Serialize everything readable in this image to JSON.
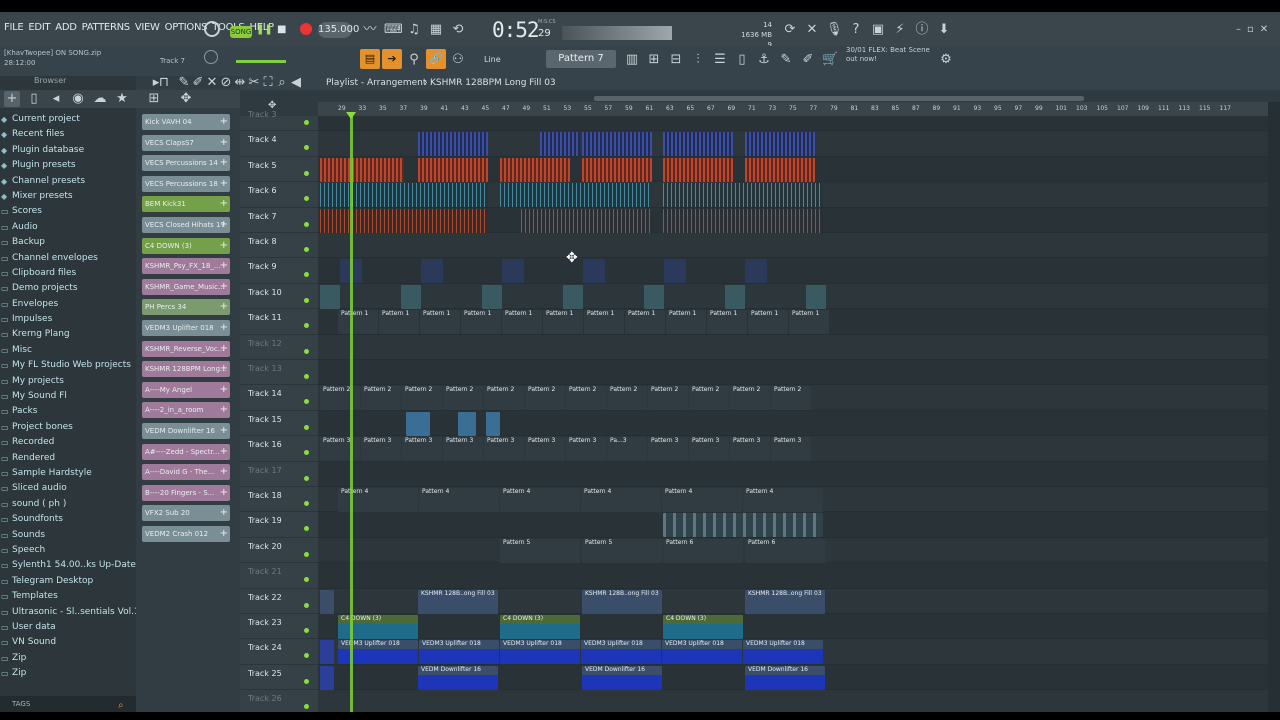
{
  "menu": [
    "FILE",
    "EDIT",
    "ADD",
    "PATTERNS",
    "VIEW",
    "OPTIONS",
    "TOOLS",
    "HELP"
  ],
  "transport": {
    "song_label": "SONG",
    "tempo": "135.000",
    "time": "0:52",
    "time_small": "29",
    "time_label": "M:S:CS"
  },
  "cpu": {
    "line1": "14",
    "line2": "1636 MB",
    "line3": "9"
  },
  "file": {
    "user": "[KhavTwopee]",
    "song": "ON SONG.zip",
    "time": "28:12:00"
  },
  "hint_track": "Track 7",
  "snap": "Line",
  "pattern_selector": "Pattern 7",
  "hint": {
    "line1": "30/01  FLEX: Beat Scene",
    "line2": "out now!"
  },
  "browser": {
    "title": "Browser",
    "items": [
      "Current project",
      "Recent files",
      "Plugin database",
      "Plugin presets",
      "Channel presets",
      "Mixer presets",
      "Scores",
      "Audio",
      "Backup",
      "Channel envelopes",
      "Clipboard files",
      "Demo projects",
      "Envelopes",
      "Impulses",
      "Krerng Plang",
      "Misc",
      "My FL Studio Web projects",
      "My projects",
      "My Sound Fl",
      "Packs",
      "Project bones",
      "Recorded",
      "Rendered",
      "Sample Hardstyle",
      "Sliced audio",
      "sound ( ph )",
      "Soundfonts",
      "Sounds",
      "Speech",
      "Sylenth1 54.00..ks Up-Date 5",
      "Telegram Desktop",
      "Templates",
      "Ultrasonic - Sl..sentials Vol.1",
      "User data",
      "VN Sound",
      "Zip",
      "Zip"
    ],
    "tags": "TAGS"
  },
  "channels": [
    {
      "name": "Kick VAVH 04",
      "color": "#7a8e95"
    },
    {
      "name": "VECS ClapsS7",
      "color": "#7a8e95"
    },
    {
      "name": "VECS Percussions 14",
      "color": "#7a8e95"
    },
    {
      "name": "VECS Percussions 18",
      "color": "#7a8e95"
    },
    {
      "name": "BEM Kick31",
      "color": "#74a04a"
    },
    {
      "name": "VECS Closed Hihats 17",
      "color": "#7a8e95"
    },
    {
      "name": "C4 DOWN (3)",
      "color": "#74a04a"
    },
    {
      "name": "KSHMR_Psy_FX_18_...",
      "color": "#a07a9a"
    },
    {
      "name": "KSHMR_Game_Music...",
      "color": "#a07a9a"
    },
    {
      "name": "PH Percs 34",
      "color": "#7b9a6e"
    },
    {
      "name": "VEDM3 Uplifter 018",
      "color": "#7a8e95"
    },
    {
      "name": "KSHMR_Reverse_Voc...",
      "color": "#a07a9a"
    },
    {
      "name": "KSHMR 128BPM Long...",
      "color": "#a07a9a"
    },
    {
      "name": "A----My Angel",
      "color": "#a07a9a"
    },
    {
      "name": "A----2_in_a_room",
      "color": "#a07a9a"
    },
    {
      "name": "VEDM Downlifter 16",
      "color": "#7a8e95"
    },
    {
      "name": "A#----Zedd - Spectr...",
      "color": "#a07a9a"
    },
    {
      "name": "A----David G - The...",
      "color": "#a07a9a"
    },
    {
      "name": "B----20 Fingers - S...",
      "color": "#a07a9a"
    },
    {
      "name": "VFX2 Sub 20",
      "color": "#7a8e95"
    },
    {
      "name": "VEDM2 Crash 012",
      "color": "#7a8e95"
    }
  ],
  "playlist": {
    "title": "Playlist - Arrangement",
    "crumb": "KSHMR 128BPM Long Fill 03"
  },
  "ruler": [
    "29",
    "33",
    "35",
    "37",
    "39",
    "41",
    "43",
    "45",
    "47",
    "49",
    "51",
    "53",
    "55",
    "57",
    "59",
    "61",
    "63",
    "65",
    "67",
    "69",
    "71",
    "73",
    "75",
    "77",
    "79",
    "81",
    "83",
    "85",
    "87",
    "89",
    "91",
    "93",
    "95",
    "97",
    "99",
    "101",
    "103",
    "105",
    "107",
    "109",
    "111",
    "113",
    "115",
    "117"
  ],
  "tracks": [
    {
      "name": "Track 3",
      "dim": true
    },
    {
      "name": "Track 4",
      "dim": false
    },
    {
      "name": "Track 5",
      "dim": false
    },
    {
      "name": "Track 6",
      "dim": false
    },
    {
      "name": "Track 7",
      "dim": false
    },
    {
      "name": "Track 8",
      "dim": false
    },
    {
      "name": "Track 9",
      "dim": false
    },
    {
      "name": "Track 10",
      "dim": false
    },
    {
      "name": "Track 11",
      "dim": false
    },
    {
      "name": "Track 12",
      "dim": true
    },
    {
      "name": "Track 13",
      "dim": true
    },
    {
      "name": "Track 14",
      "dim": false
    },
    {
      "name": "Track 15",
      "dim": false
    },
    {
      "name": "Track 16",
      "dim": false
    },
    {
      "name": "Track 17",
      "dim": true
    },
    {
      "name": "Track 18",
      "dim": false
    },
    {
      "name": "Track 19",
      "dim": false
    },
    {
      "name": "Track 20",
      "dim": false
    },
    {
      "name": "Track 21",
      "dim": true
    },
    {
      "name": "Track 22",
      "dim": false
    },
    {
      "name": "Track 23",
      "dim": false
    },
    {
      "name": "Track 24",
      "dim": false
    },
    {
      "name": "Track 25",
      "dim": false
    },
    {
      "name": "Track 26",
      "dim": true
    }
  ],
  "clip_labels": {
    "t11": "Pattern 1",
    "t14": "Pattern 2",
    "t16": "Pattern 3",
    "t16_short": "Pa...3",
    "t18": "Pattern 4",
    "t20a": "Pattern 5",
    "t20b": "Pattern 6",
    "t22": "KSHMR 128B..ong Fill 03",
    "t23": "C4 DOWN (3)",
    "t24": "VEDM3 Uplifter 018",
    "t25": "VEDM Downlifter 16"
  }
}
